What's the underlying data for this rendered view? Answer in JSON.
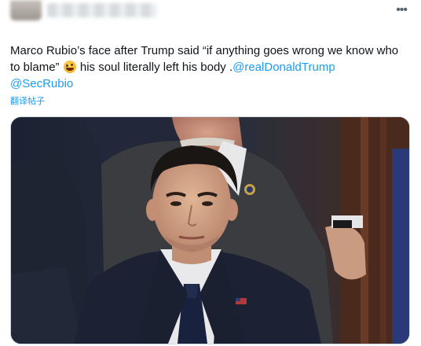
{
  "tweet": {
    "text_part1": "Marco Rubio’s face after Trump said “if anything goes wrong we know who to blame” ",
    "emoji_icon": "rolling-on-floor-laughing-emoji",
    "text_part2": " his soul literally left his body .",
    "mention1": "@realDonaldTrump",
    "mention2": "@SecRubio",
    "translate_label": "翻译帖子",
    "more_icon": "more-horizontal-icon"
  },
  "colors": {
    "link": "#1d9bf0",
    "text": "#0f1419",
    "muted": "#536471"
  }
}
